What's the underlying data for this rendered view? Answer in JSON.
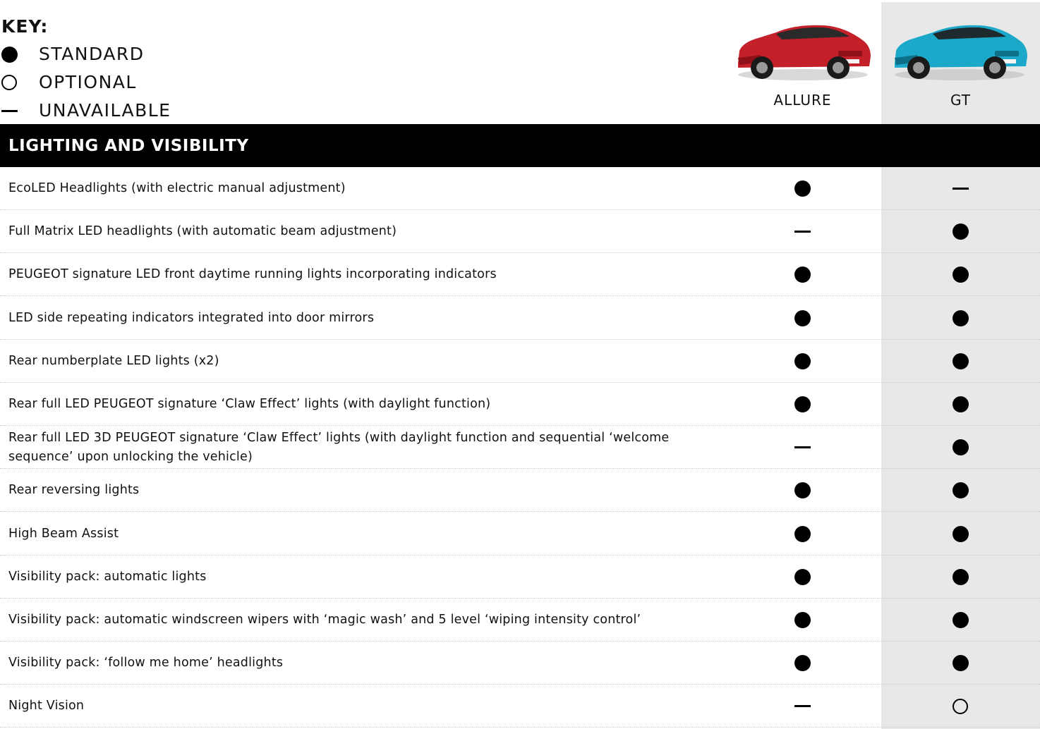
{
  "key": {
    "title": "KEY:",
    "items": [
      {
        "symbol": "standard",
        "label": "STANDARD"
      },
      {
        "symbol": "optional",
        "label": "OPTIONAL"
      },
      {
        "symbol": "unavailable",
        "label": "UNAVAILABLE"
      }
    ]
  },
  "columns": [
    {
      "label": "ALLURE",
      "car_color": "#c4202a"
    },
    {
      "label": "GT",
      "car_color": "#1ba8c9"
    }
  ],
  "section": {
    "title": "LIGHTING AND VISIBILITY"
  },
  "rows": [
    {
      "label": "EcoLED Headlights (with electric manual adjustment)",
      "allure": "standard",
      "gt": "unavailable"
    },
    {
      "label": "Full Matrix LED headlights (with automatic beam adjustment)",
      "allure": "unavailable",
      "gt": "standard"
    },
    {
      "label": "PEUGEOT signature LED front daytime running lights incorporating indicators",
      "allure": "standard",
      "gt": "standard"
    },
    {
      "label": "LED side repeating indicators integrated into door mirrors",
      "allure": "standard",
      "gt": "standard"
    },
    {
      "label": "Rear numberplate LED lights (x2)",
      "allure": "standard",
      "gt": "standard"
    },
    {
      "label": "Rear full LED PEUGEOT signature ‘Claw Effect’ lights (with daylight function)",
      "allure": "standard",
      "gt": "standard"
    },
    {
      "label": "Rear full LED 3D PEUGEOT signature ‘Claw Effect’ lights (with daylight function and sequential ‘welcome sequence’ upon unlocking the vehicle)",
      "allure": "unavailable",
      "gt": "standard"
    },
    {
      "label": "Rear reversing lights",
      "allure": "standard",
      "gt": "standard"
    },
    {
      "label": "High Beam Assist",
      "allure": "standard",
      "gt": "standard"
    },
    {
      "label": "Visibility pack: automatic lights",
      "allure": "standard",
      "gt": "standard"
    },
    {
      "label": "Visibility pack: automatic windscreen wipers with ‘magic wash’ and 5 level ‘wiping intensity control’",
      "allure": "standard",
      "gt": "standard"
    },
    {
      "label": "Visibility pack: ‘follow me home’ headlights",
      "allure": "standard",
      "gt": "standard"
    },
    {
      "label": "Night Vision",
      "allure": "unavailable",
      "gt": "optional"
    }
  ]
}
